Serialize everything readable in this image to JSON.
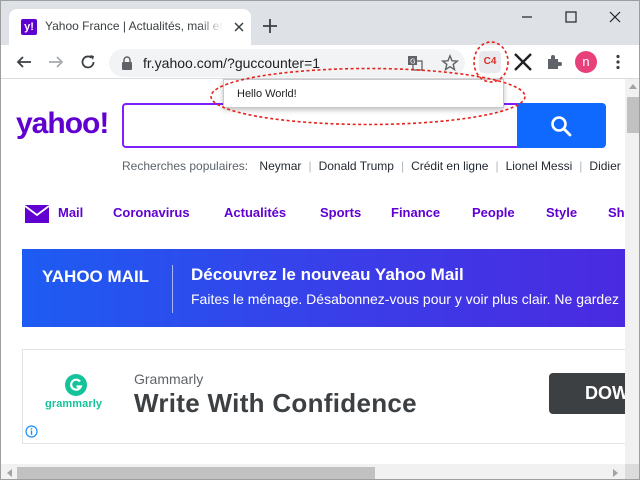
{
  "browser": {
    "tab_title": "Yahoo France | Actualités, mail et recherche",
    "favicon_letter": "y!",
    "url": "fr.yahoo.com/?guccounter=1",
    "extension_badge": "C4",
    "profile_initial": "n",
    "colors": {
      "tabstrip": "#dee1e6",
      "omnibox": "#f1f3f4",
      "avatar": "#e8407a",
      "badge_text": "#d93025"
    }
  },
  "popup": {
    "text": "Hello World!",
    "highlight_color": "#e8211b"
  },
  "page": {
    "logo": "yahoo!",
    "popular_label": "Recherches populaires:",
    "popular_terms": [
      "Neymar",
      "Donald Trump",
      "Crédit en ligne",
      "Lionel Messi",
      "Didier"
    ],
    "nav": [
      "Mail",
      "Coronavirus",
      "Actualités",
      "Sports",
      "Finance",
      "People",
      "Style",
      "Sh"
    ],
    "banner": {
      "brand": "YAHOO MAIL",
      "title": "Découvrez le nouveau Yahoo Mail",
      "subtitle": "Faites le ménage. Désabonnez-vous pour y voir plus clair. Ne gardez"
    },
    "ad": {
      "logo_text": "grammarly",
      "brand": "Grammarly",
      "title": "Write With Confidence",
      "cta": "DOWNLOAD"
    },
    "colors": {
      "brand_purple": "#6001d2",
      "search_blue": "#0f69ff",
      "grammarly_green": "#15c39a"
    }
  }
}
